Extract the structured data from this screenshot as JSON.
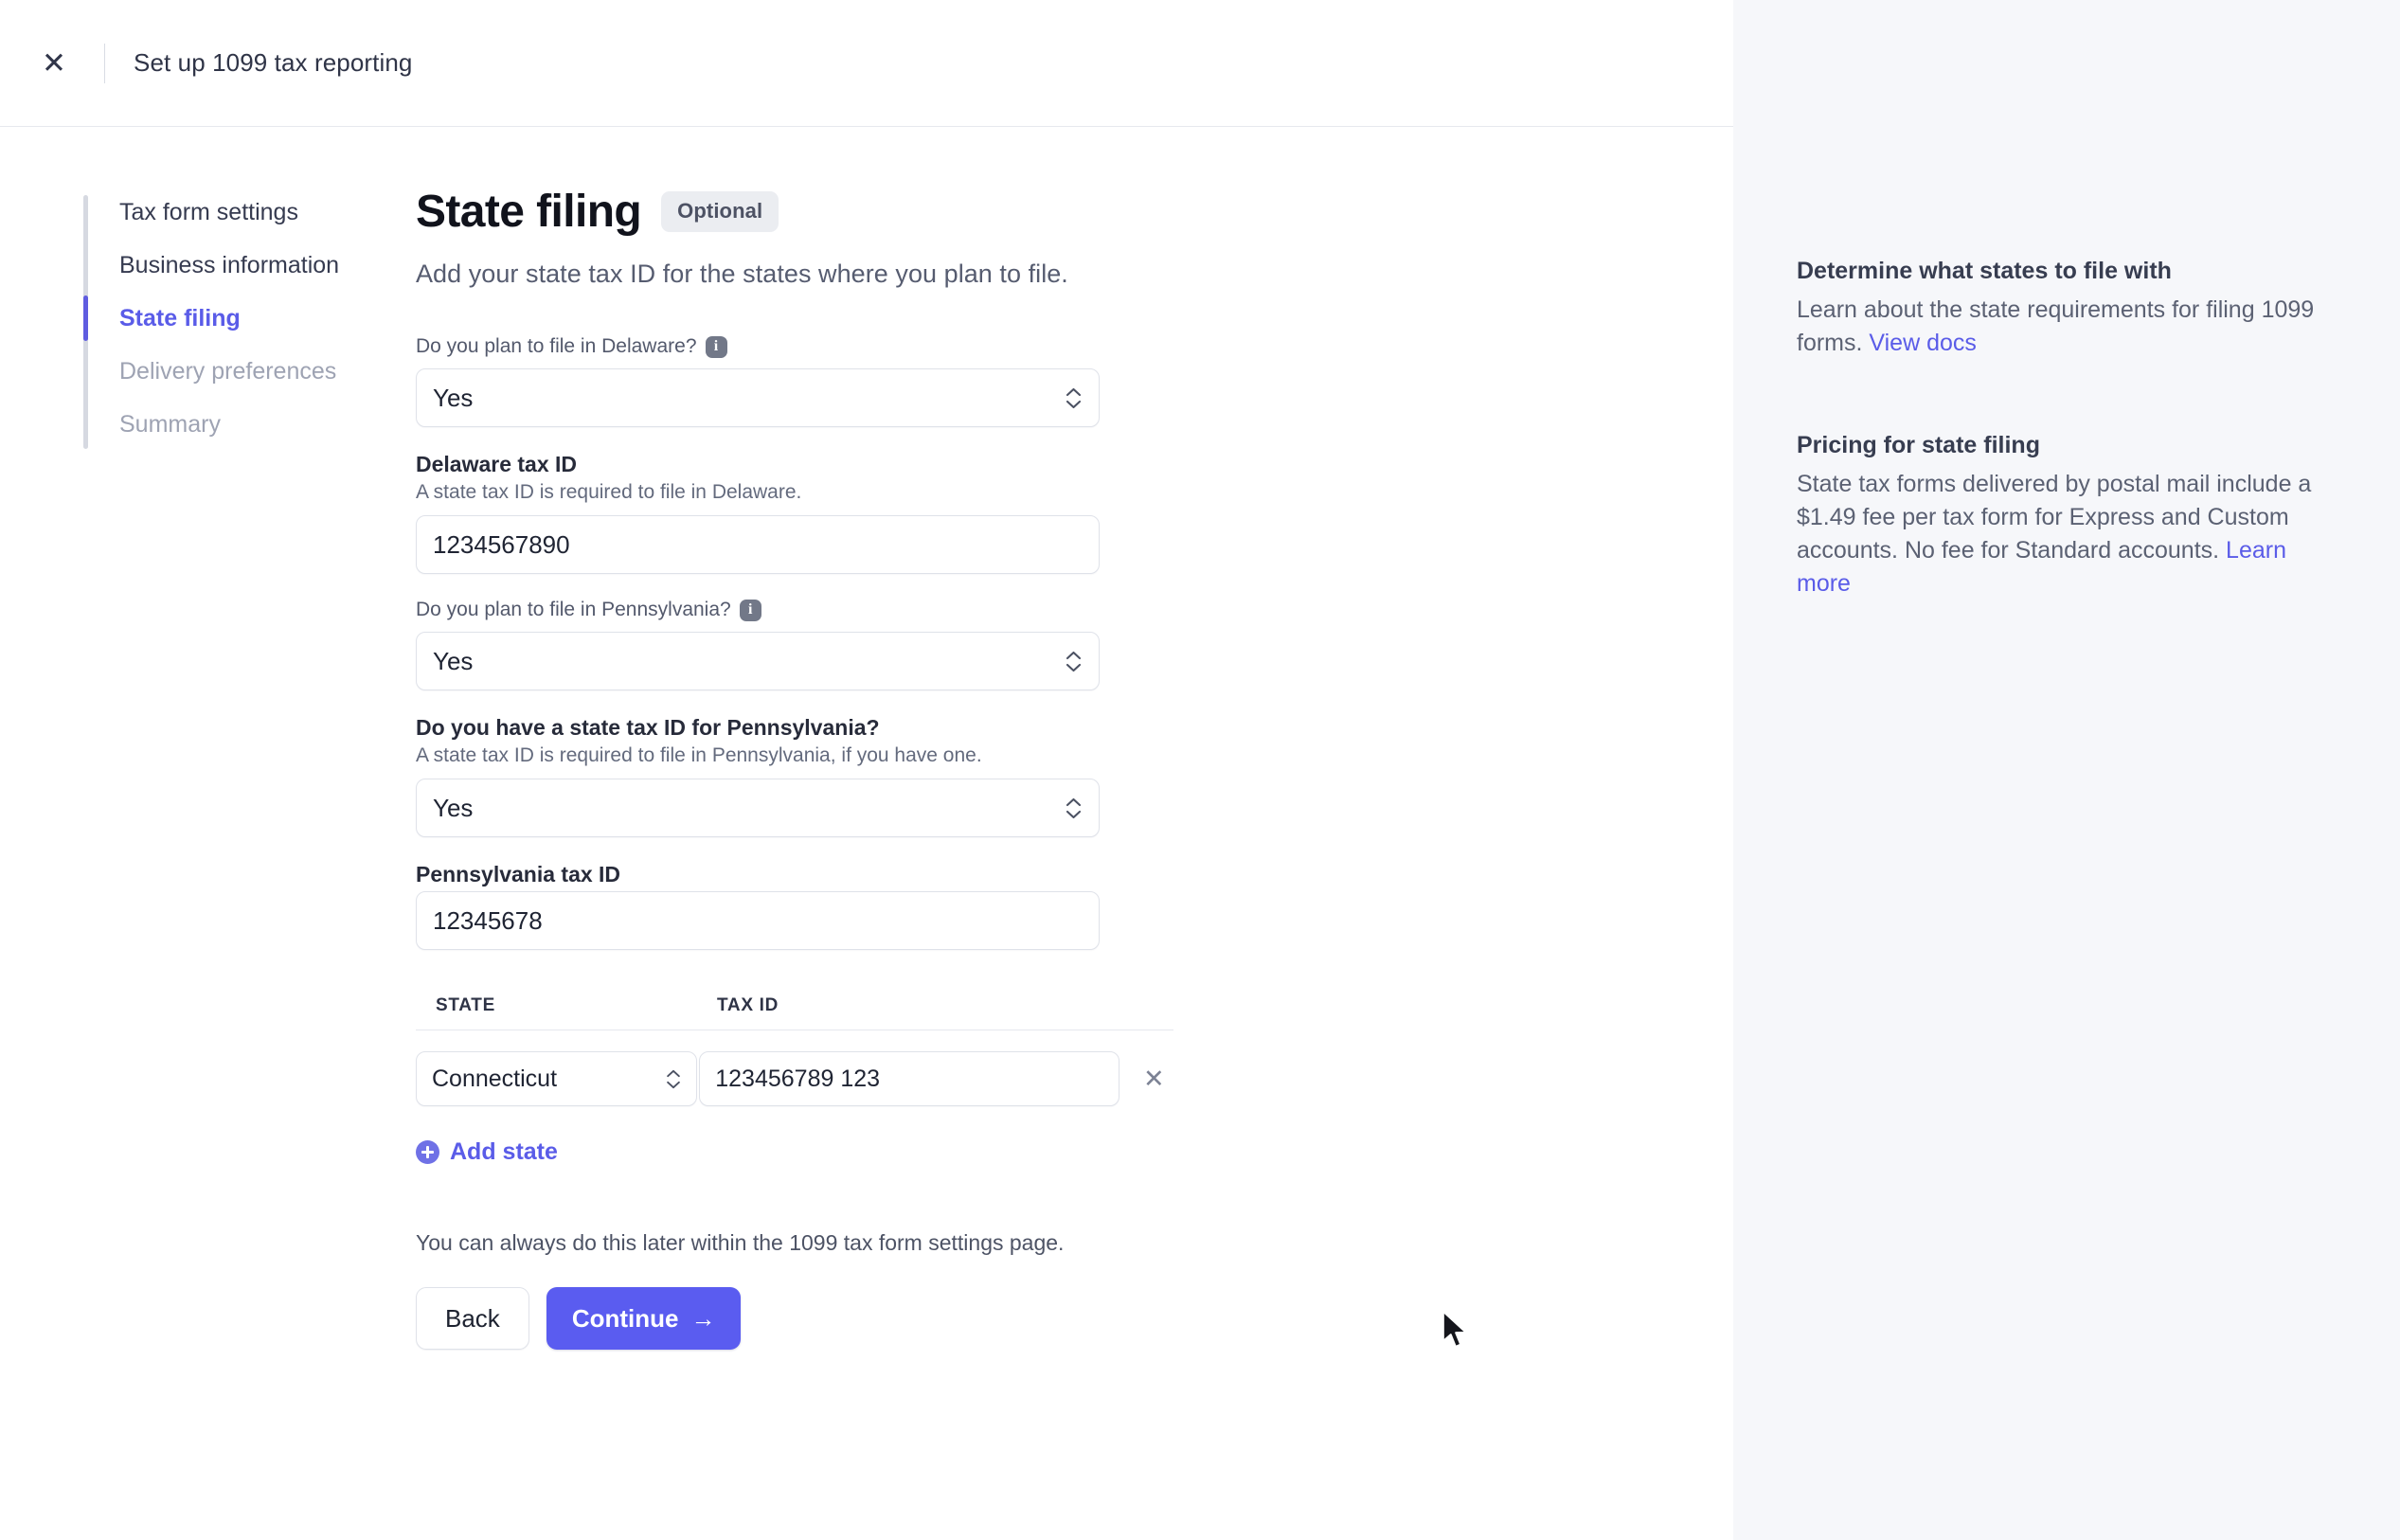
{
  "topbar": {
    "close_icon": "close-icon",
    "title": "Set up 1099 tax reporting"
  },
  "stepper": {
    "items": [
      {
        "label": "Tax form settings",
        "state": "done"
      },
      {
        "label": "Business information",
        "state": "done"
      },
      {
        "label": "State filing",
        "state": "active"
      },
      {
        "label": "Delivery preferences",
        "state": "upcoming"
      },
      {
        "label": "Summary",
        "state": "upcoming"
      }
    ]
  },
  "page": {
    "title": "State filing",
    "badge": "Optional",
    "subtitle": "Add your state tax ID for the states where you plan to file."
  },
  "fields": {
    "delaware_plan": {
      "question": "Do you plan to file in Delaware?",
      "info_icon": "info-icon",
      "value": "Yes"
    },
    "delaware_tax_id": {
      "label": "Delaware tax ID",
      "help": "A state tax ID is required to file in Delaware.",
      "value": "1234567890"
    },
    "pennsylvania_plan": {
      "question": "Do you plan to file in Pennsylvania?",
      "info_icon": "info-icon",
      "value": "Yes"
    },
    "pennsylvania_has_id": {
      "label": "Do you have a state tax ID for Pennsylvania?",
      "help": "A state tax ID is required to file in Pennsylvania, if you have one.",
      "value": "Yes"
    },
    "pennsylvania_tax_id": {
      "label": "Pennsylvania tax ID",
      "value": "12345678"
    }
  },
  "states_table": {
    "columns": [
      "STATE",
      "TAX ID"
    ],
    "rows": [
      {
        "state": "Connecticut",
        "tax_id": "123456789 123",
        "remove_icon": "close-icon"
      }
    ],
    "add_label": "Add state",
    "add_icon": "plus-circle-icon"
  },
  "footer": {
    "note": "You can always do this later within the 1099 tax form settings page.",
    "back_label": "Back",
    "continue_label": "Continue",
    "continue_arrow": "→"
  },
  "help": {
    "blocks": [
      {
        "title": "Determine what states to file with",
        "text": "Learn about the state requirements for filing 1099 forms. ",
        "link": "View docs"
      },
      {
        "title": "Pricing for state filing",
        "text": "State tax forms delivered by postal mail include a $1.49 fee per tax form for Express and Custom accounts. No fee for Standard accounts. ",
        "link": "Learn more"
      }
    ]
  },
  "colors": {
    "accent": "#5a5cf0",
    "link": "#5a5ce8",
    "panel_bg": "#f6f7fa",
    "border": "#dfe2e9"
  }
}
